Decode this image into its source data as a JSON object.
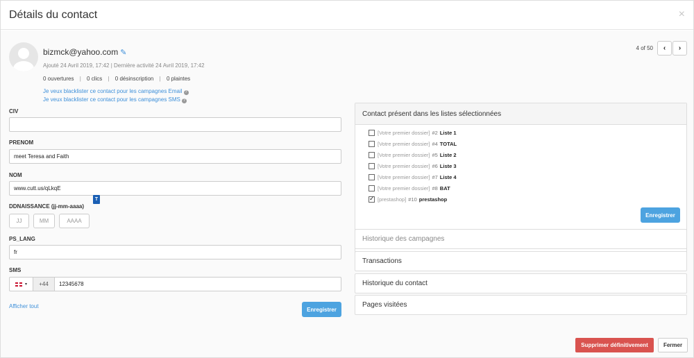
{
  "modal": {
    "title": "Détails du contact",
    "close_glyph": "×"
  },
  "contact": {
    "email": "bizmck@yahoo.com",
    "added": "Ajouté 24 Avril 2019, 17:42",
    "dates_separator": "|",
    "last_activity": "Dernière activité 24 Avril 2019, 17:42",
    "stats": {
      "opens": "0 ouvertures",
      "clicks": "0 clics",
      "unsubscribes": "0 désinscription",
      "complaints": "0 plaintes",
      "separator": "|"
    },
    "blacklist_email": "Je veux blacklister ce contact pour les campagnes Email",
    "blacklist_sms": "Je veux blacklister ce contact pour les campagnes SMS",
    "help_glyph": "?"
  },
  "pager": {
    "count": "4 of 50",
    "prev_glyph": "‹",
    "next_glyph": "›"
  },
  "form": {
    "civ": {
      "label": "CIV",
      "value": ""
    },
    "prenom": {
      "label": "PRENOM",
      "value": "meet Teresa and Faith"
    },
    "nom": {
      "label": "NOM",
      "value": "www.cutt.us/qLkqE"
    },
    "tooltip": "T",
    "birthdate": {
      "label": "DDNAISSANCE (jj-mm-aaaa)",
      "day_placeholder": "JJ",
      "month_placeholder": "MM",
      "year_placeholder": "AAAA"
    },
    "lang": {
      "label": "PS_LANG",
      "value": "fr"
    },
    "sms": {
      "label": "SMS",
      "caret_glyph": "▾",
      "prefix": "+44",
      "value": "12345678"
    },
    "show_all": "Afficher tout",
    "save": "Enregistrer"
  },
  "lists_panel": {
    "title": "Contact présent dans les listes sélectionnées",
    "items": [
      {
        "folder": "[Votre premier dossier]",
        "id": "#2",
        "name": "Liste 1",
        "checked": false
      },
      {
        "folder": "[Votre premier dossier]",
        "id": "#4",
        "name": "TOTAL",
        "checked": false
      },
      {
        "folder": "[Votre premier dossier]",
        "id": "#5",
        "name": "Liste 2",
        "checked": false
      },
      {
        "folder": "[Votre premier dossier]",
        "id": "#6",
        "name": "Liste 3",
        "checked": false
      },
      {
        "folder": "[Votre premier dossier]",
        "id": "#7",
        "name": "Liste 4",
        "checked": false
      },
      {
        "folder": "[Votre premier dossier]",
        "id": "#8",
        "name": "BAT",
        "checked": false
      },
      {
        "folder": "[prestashop]",
        "id": "#10",
        "name": "prestashop",
        "checked": true
      }
    ],
    "save": "Enregistrer"
  },
  "sections": {
    "campaigns": "Historique des campagnes",
    "transactions": "Transactions",
    "history": "Historique du contact",
    "pages": "Pages visitées"
  },
  "footer": {
    "delete": "Supprimer définitivement",
    "close": "Fermer"
  },
  "colors": {
    "primary": "#4da3e0",
    "danger": "#d9534f",
    "link": "#3d8fd9"
  }
}
